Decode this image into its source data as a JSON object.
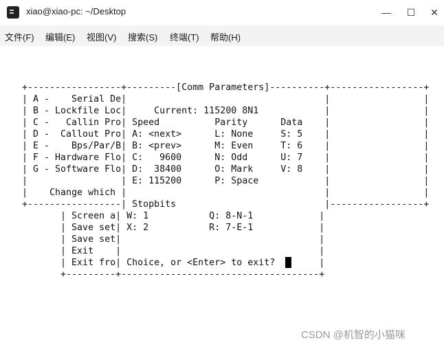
{
  "window": {
    "title": "xiao@xiao-pc: ~/Desktop",
    "minimize_glyph": "—",
    "maximize_glyph": "☐",
    "close_glyph": "✕"
  },
  "menu": [
    "文件(F)",
    "编辑(E)",
    "视图(V)",
    "搜索(S)",
    "终端(T)",
    "帮助(H)"
  ],
  "terminal_lines": [
    "+-----------------+---------[Comm Parameters]----------+-----------------+",
    "| A -    Serial De|                                    |                 |",
    "| B - Lockfile Loc|     Current: 115200 8N1            |                 |",
    "| C -   Callin Pro| Speed          Parity      Data    |                 |",
    "| D -  Callout Pro| A: <next>      L: None     S: 5    |                 |",
    "| E -    Bps/Par/B| B: <prev>      M: Even     T: 6    |                 |",
    "| F - Hardware Flo| C:   9600      N: Odd      U: 7    |                 |",
    "| G - Software Flo| D:  38400      O: Mark     V: 8    |                 |",
    "|                 | E: 115200      P: Space            |                 |",
    "|    Change which |                                    |                 |",
    "+-----------------| Stopbits                           |-----------------+",
    "       | Screen a| W: 1           Q: 8-N-1            |",
    "       | Save set| X: 2           R: 7-E-1            |",
    "       | Save set|                                    |",
    "       | Exit    |                                    |",
    "       | Exit fro| Choice, or <Enter> to exit?        |",
    "       +---------+------------------------------------+"
  ],
  "watermark": "CSDN @机智的小猫咪"
}
